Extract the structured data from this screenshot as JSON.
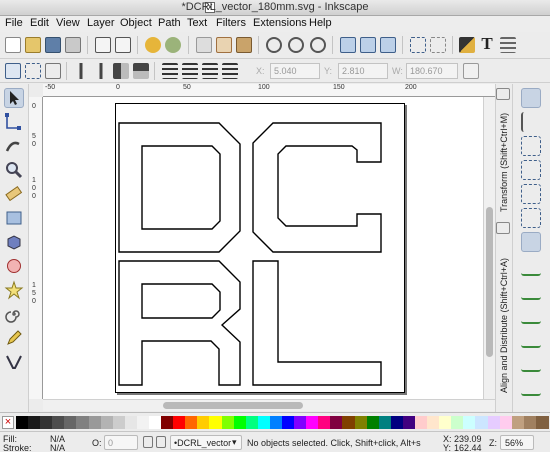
{
  "window": {
    "title": "*DCRL_vector_180mm.svg - Inkscape",
    "icon_glyph": "X"
  },
  "menu": [
    "File",
    "Edit",
    "View",
    "Layer",
    "Object",
    "Path",
    "Text",
    "Filters",
    "Extensions",
    "Help"
  ],
  "commands_toolbar": {
    "buttons": [
      "new-icon",
      "open-icon",
      "save-icon",
      "print-icon",
      "import-icon",
      "export-icon",
      "undo-icon",
      "redo-icon",
      "copy-icon",
      "cut-icon",
      "paste-icon",
      "zoom-selection-icon",
      "zoom-drawing-icon",
      "zoom-page-icon",
      "duplicate-icon",
      "clone-icon",
      "unlink-clone-icon",
      "group-icon",
      "ungroup-icon",
      "fill-stroke-icon",
      "text-tool-icon",
      "layers-icon"
    ],
    "text_glyph": "T"
  },
  "select_toolbar": {
    "x_label": "X:",
    "x_value": "5.040",
    "y_label": "Y:",
    "y_value": "2.810",
    "w_label": "W:",
    "w_value": "180.670"
  },
  "tools": [
    "selector-tool",
    "node-tool",
    "tweak-tool",
    "zoom-tool",
    "measure-tool",
    "rect-tool",
    "3dbox-tool",
    "ellipse-tool",
    "star-tool",
    "spiral-tool",
    "pencil-tool",
    "calligraphy-tool"
  ],
  "ruler": {
    "top_labels": [
      "-50",
      "0",
      "50",
      "100",
      "150",
      "200"
    ],
    "left_labels": [
      "0",
      "5",
      "0",
      "1",
      "0",
      "0",
      "1",
      "5",
      "0"
    ]
  },
  "docks": {
    "transform": "Transform (Shift+Ctrl+M)",
    "align": "Align and Distribute (Shift+Ctrl+A)"
  },
  "colors": {
    "palette": [
      "#000000",
      "#1a1a1a",
      "#333333",
      "#4d4d4d",
      "#666666",
      "#808080",
      "#999999",
      "#b3b3b3",
      "#cccccc",
      "#e6e6e6",
      "#f2f2f2",
      "#ffffff",
      "#800000",
      "#ff0000",
      "#ff6600",
      "#ffcc00",
      "#ffff00",
      "#80ff00",
      "#00ff00",
      "#00ff80",
      "#00ffff",
      "#0080ff",
      "#0000ff",
      "#8000ff",
      "#ff00ff",
      "#ff0080",
      "#800040",
      "#804000",
      "#808000",
      "#008000",
      "#008080",
      "#000080",
      "#400080",
      "#ffcccc",
      "#ffe6cc",
      "#ffffcc",
      "#ccffcc",
      "#ccffff",
      "#cce6ff",
      "#e6ccff",
      "#ffccee",
      "#c0a080",
      "#a08060",
      "#806040"
    ],
    "accent": "#c8d4e4"
  },
  "status": {
    "fill_label": "Fill:",
    "fill_value": "N/A",
    "stroke_label": "Stroke:",
    "stroke_value": "N/A",
    "opacity_label": "O:",
    "opacity_value": "0",
    "layer": "•DCRL_vector",
    "message": "No objects selected. Click, Shift+click, Alt+s",
    "x_label": "X:",
    "x_value": "239.09",
    "y_label": "Y:",
    "y_value": "162.44",
    "zoom_label": "Z:",
    "zoom_value": "56%"
  }
}
